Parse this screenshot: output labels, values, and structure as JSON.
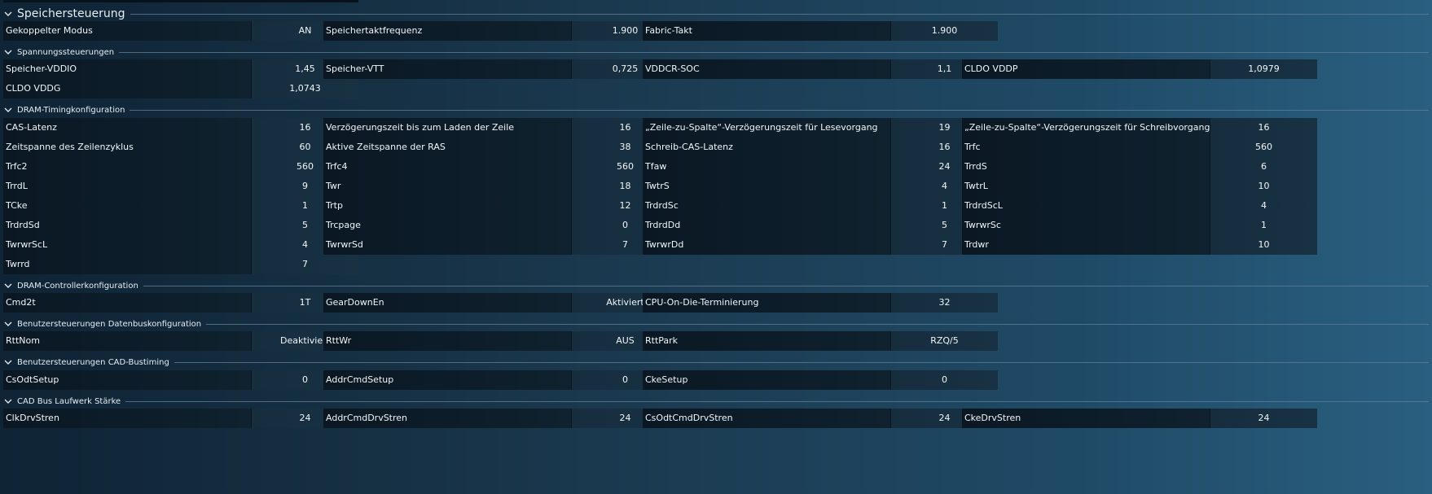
{
  "sections": [
    {
      "title": "Speichersteuerung",
      "rows": [
        [
          [
            "Gekoppelter Modus",
            "AN"
          ],
          [
            "Speichertaktfrequenz",
            "1.900"
          ],
          [
            "Fabric-Takt",
            "1.900"
          ]
        ]
      ]
    },
    {
      "title": "Spannungssteuerungen",
      "rows": [
        [
          [
            "Speicher-VDDIO",
            "1,45"
          ],
          [
            "Speicher-VTT",
            "0,725"
          ],
          [
            "VDDCR-SOC",
            "1,1"
          ],
          [
            "CLDO VDDP",
            "1,0979"
          ]
        ],
        [
          [
            "CLDO VDDG",
            "1,0743"
          ]
        ]
      ]
    },
    {
      "title": "DRAM-Timingkonfiguration",
      "rows": [
        [
          [
            "CAS-Latenz",
            "16"
          ],
          [
            "Verzögerungszeit bis zum Laden der Zeile",
            "16"
          ],
          [
            "„Zeile-zu-Spalte“-Verzögerungszeit für Lesevorgang",
            "19"
          ],
          [
            "„Zeile-zu-Spalte“-Verzögerungszeit für Schreibvorgang",
            "16"
          ]
        ],
        [
          [
            "Zeitspanne des Zeilenzyklus",
            "60"
          ],
          [
            "Aktive Zeitspanne der RAS",
            "38"
          ],
          [
            "Schreib-CAS-Latenz",
            "16"
          ],
          [
            "Trfc",
            "560"
          ]
        ],
        [
          [
            "Trfc2",
            "560"
          ],
          [
            "Trfc4",
            "560"
          ],
          [
            "Tfaw",
            "24"
          ],
          [
            "TrrdS",
            "6"
          ]
        ],
        [
          [
            "TrrdL",
            "9"
          ],
          [
            "Twr",
            "18"
          ],
          [
            "TwtrS",
            "4"
          ],
          [
            "TwtrL",
            "10"
          ]
        ],
        [
          [
            "TCke",
            "1"
          ],
          [
            "Trtp",
            "12"
          ],
          [
            "TrdrdSc",
            "1"
          ],
          [
            "TrdrdScL",
            "4"
          ]
        ],
        [
          [
            "TrdrdSd",
            "5"
          ],
          [
            "Trcpage",
            "0"
          ],
          [
            "TrdrdDd",
            "5"
          ],
          [
            "TwrwrSc",
            "1"
          ]
        ],
        [
          [
            "TwrwrScL",
            "4"
          ],
          [
            "TwrwrSd",
            "7"
          ],
          [
            "TwrwrDd",
            "7"
          ],
          [
            "Trdwr",
            "10"
          ]
        ],
        [
          [
            "Twrrd",
            "7"
          ]
        ]
      ]
    },
    {
      "title": "DRAM-Controllerkonfiguration",
      "rows": [
        [
          [
            "Cmd2t",
            "1T"
          ],
          [
            "GearDownEn",
            "Aktiviert"
          ],
          [
            "CPU-On-Die-Terminierung",
            "32"
          ]
        ]
      ]
    },
    {
      "title": "Benutzersteuerungen Datenbuskonfiguration",
      "rows": [
        [
          [
            "RttNom",
            "Deaktiviert"
          ],
          [
            "RttWr",
            "AUS"
          ],
          [
            "RttPark",
            "RZQ/5"
          ]
        ]
      ]
    },
    {
      "title": "Benutzersteuerungen CAD-Bustiming",
      "rows": [
        [
          [
            "CsOdtSetup",
            "0"
          ],
          [
            "AddrCmdSetup",
            "0"
          ],
          [
            "CkeSetup",
            "0"
          ]
        ]
      ]
    },
    {
      "title": "CAD Bus Laufwerk Stärke",
      "rows": [
        [
          [
            "ClkDrvStren",
            "24"
          ],
          [
            "AddrCmdDrvStren",
            "24"
          ],
          [
            "CsOdtCmdDrvStren",
            "24"
          ],
          [
            "CkeDrvStren",
            "24"
          ]
        ]
      ]
    }
  ]
}
